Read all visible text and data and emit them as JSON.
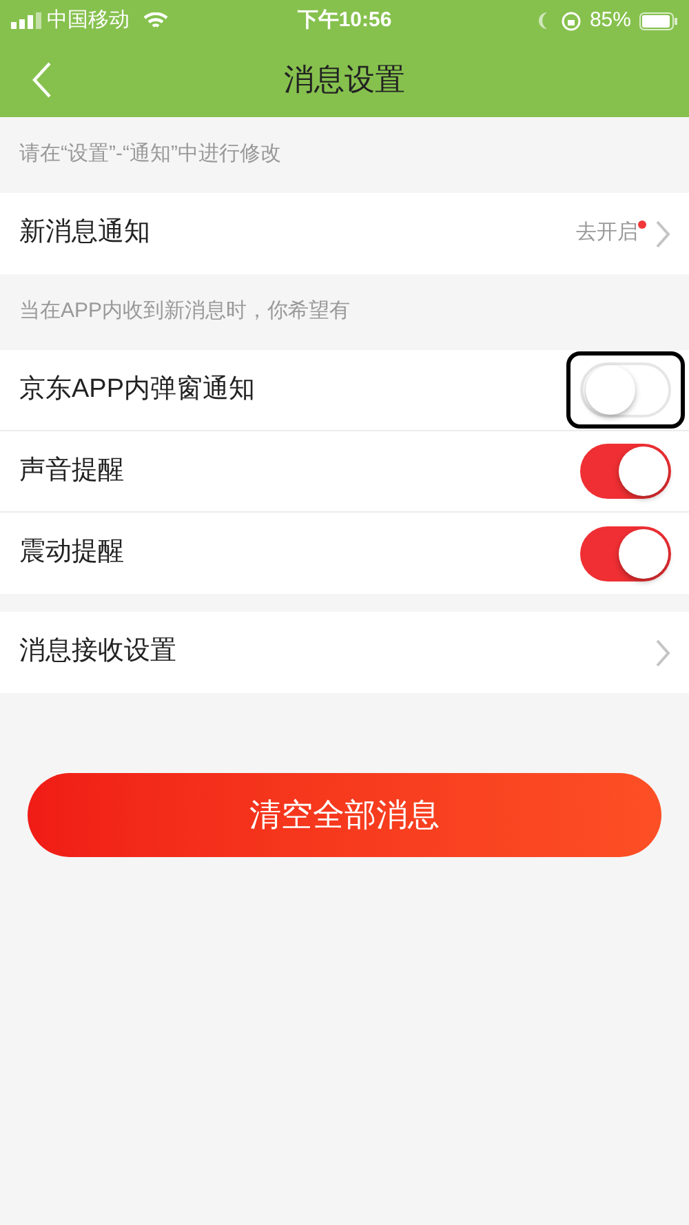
{
  "status_bar": {
    "carrier": "中国移动",
    "time": "下午10:56",
    "battery": "85%"
  },
  "nav": {
    "title": "消息设置"
  },
  "sections": [
    {
      "note": "请在“设置”-“通知”中进行修改",
      "rows": [
        {
          "kind": "link",
          "label": "新消息通知",
          "value": "去开启",
          "dot": true
        }
      ]
    },
    {
      "note": "当在APP内收到新消息时，你希望有",
      "rows": [
        {
          "kind": "toggle",
          "label": "京东APP内弹窗通知",
          "on": false,
          "highlighted": true
        },
        {
          "kind": "toggle",
          "label": "声音提醒",
          "on": true,
          "highlighted": false
        },
        {
          "kind": "toggle",
          "label": "震动提醒",
          "on": true,
          "highlighted": false
        }
      ]
    },
    {
      "rows": [
        {
          "kind": "link",
          "label": "消息接收设置"
        }
      ]
    }
  ],
  "clear_button": "清空全部消息"
}
